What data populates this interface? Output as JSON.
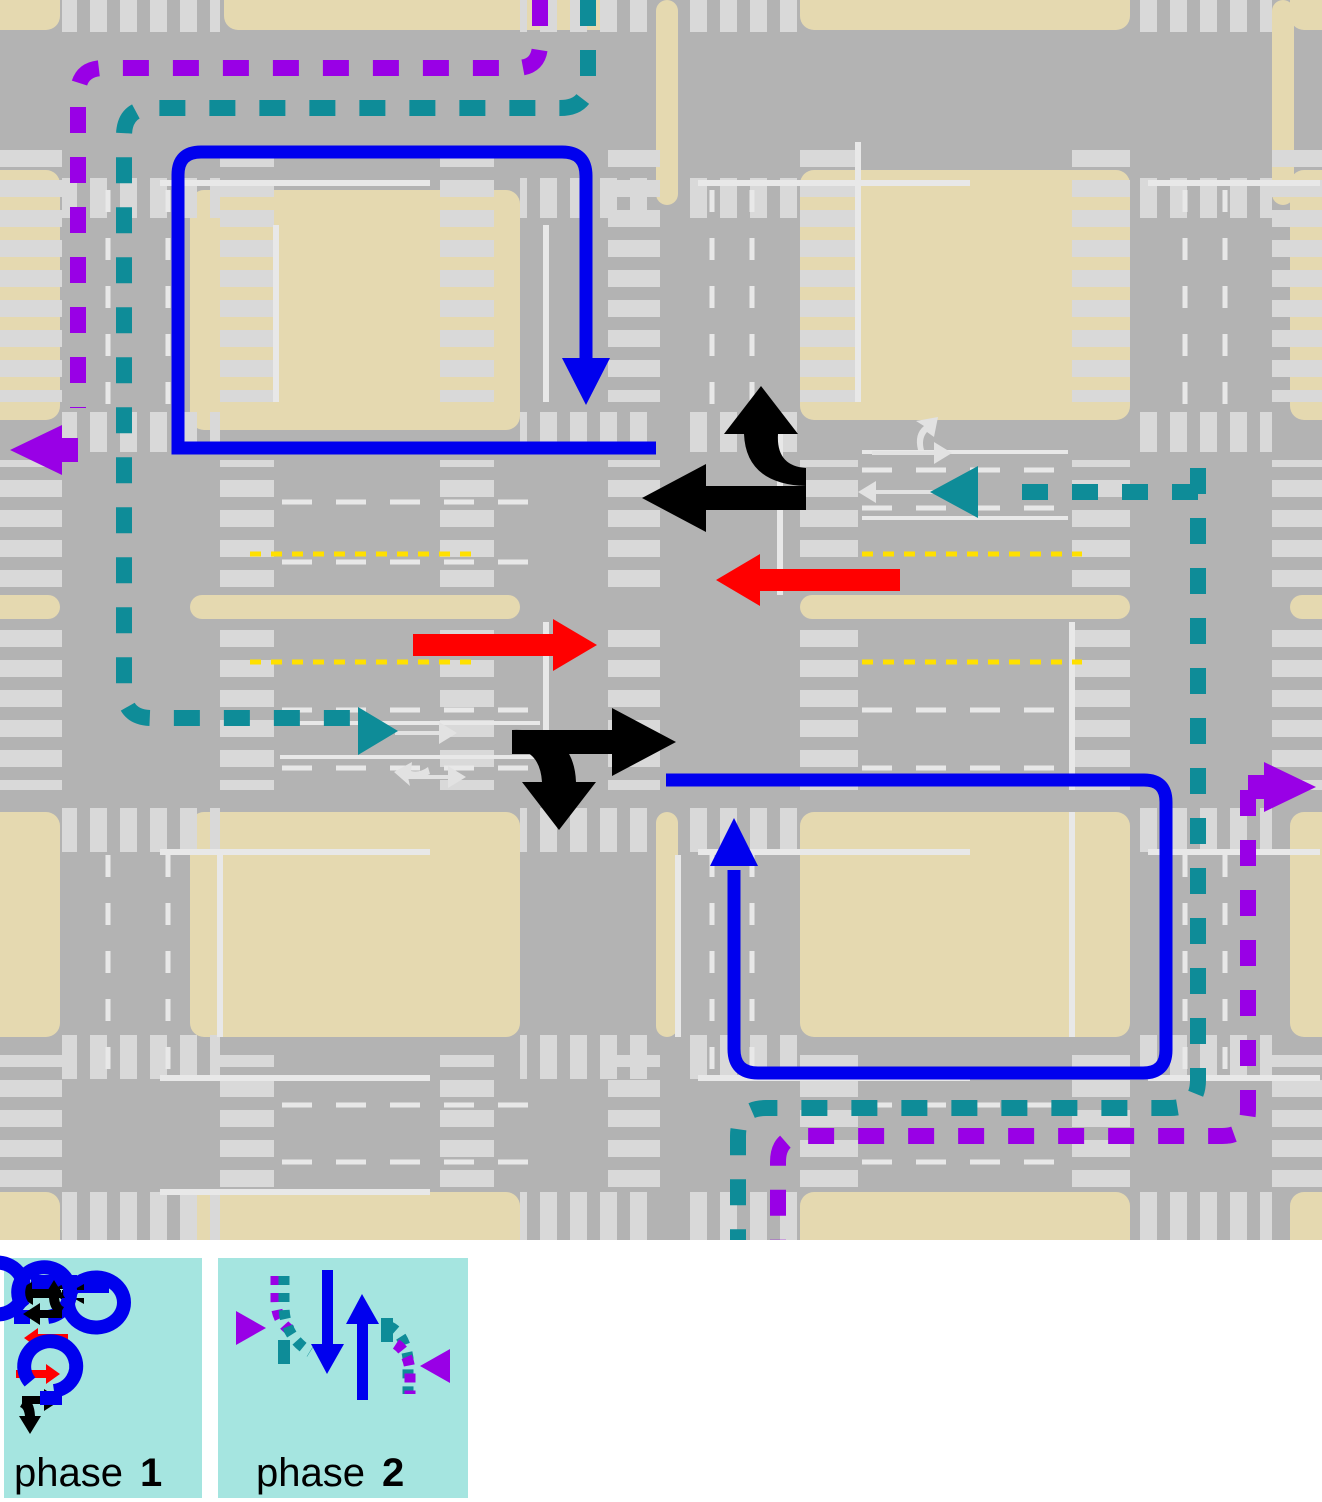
{
  "diagram": {
    "title": "Two-phase intersection signal movement diagram",
    "type": "traffic-network-map"
  },
  "colors": {
    "background_block": "#e5d9b0",
    "road": "#b3b3b3",
    "crosswalk": "#d9d9d9",
    "lane_marking": "#e8e8e8",
    "center_line_yellow": "#ffe000",
    "route_blue": "#0000ee",
    "route_red": "#ff0000",
    "route_black": "#000000",
    "route_teal": "#0e8c98",
    "route_purple": "#9900e6",
    "legend_panel": "#a5e5e0",
    "legend_text": "#000000",
    "page_background": "#ffffff"
  },
  "map": {
    "routes": [
      {
        "name": "blue-loop-upper-left",
        "color": "#0000ee",
        "style": "solid",
        "phase": 1,
        "movement": "u-turn-around-block",
        "arrow_direction": "down"
      },
      {
        "name": "blue-loop-lower-right",
        "color": "#0000ee",
        "style": "solid",
        "phase": 1,
        "movement": "u-turn-around-block",
        "arrow_direction": "up"
      },
      {
        "name": "red-arrow-westbound",
        "color": "#ff0000",
        "style": "solid",
        "phase": 1,
        "movement": "through-west"
      },
      {
        "name": "red-arrow-eastbound",
        "color": "#ff0000",
        "style": "solid",
        "phase": 1,
        "movement": "through-east"
      },
      {
        "name": "black-arrow-west-and-north",
        "color": "#000000",
        "style": "solid",
        "phase": 1,
        "movement": "through-west-plus-right-turn-north"
      },
      {
        "name": "black-arrow-east-and-south",
        "color": "#000000",
        "style": "solid",
        "phase": 1,
        "movement": "through-east-plus-right-turn-south"
      },
      {
        "name": "teal-dashed-route-upper",
        "color": "#0e8c98",
        "style": "dashed",
        "phase": 2,
        "movement": "left-turn-path"
      },
      {
        "name": "teal-dashed-route-lower",
        "color": "#0e8c98",
        "style": "dashed",
        "phase": 2,
        "movement": "left-turn-path"
      },
      {
        "name": "purple-dashed-route-upper",
        "color": "#9900e6",
        "style": "dashed",
        "phase": 2,
        "movement": "left-turn-path",
        "arrow_direction": "west"
      },
      {
        "name": "purple-dashed-route-lower",
        "color": "#9900e6",
        "style": "dashed",
        "phase": 2,
        "movement": "left-turn-path",
        "arrow_direction": "east"
      }
    ],
    "pavement_arrows": [
      {
        "name": "left-turn-and-through-marking-upper-right",
        "direction": "west"
      },
      {
        "name": "through-marking-upper-right",
        "direction": "west"
      },
      {
        "name": "through-marking-center-left",
        "direction": "east"
      },
      {
        "name": "right-turn-and-through-marking-center-left",
        "direction": "east"
      }
    ]
  },
  "legend": {
    "panels": [
      {
        "id": "phase-1",
        "label_prefix": "phase",
        "label_number": "1",
        "movements": [
          {
            "color": "#0000ee",
            "kind": "u-turn",
            "position": "top-left"
          },
          {
            "color": "#000000",
            "kind": "through-west-and-right-north",
            "position": "top-middle"
          },
          {
            "color": "#ff0000",
            "kind": "through-west",
            "position": "upper"
          },
          {
            "color": "#ff0000",
            "kind": "through-east",
            "position": "lower"
          },
          {
            "color": "#000000",
            "kind": "through-east-and-right-south",
            "position": "bottom-middle"
          },
          {
            "color": "#0000ee",
            "kind": "u-turn",
            "position": "bottom-right"
          }
        ]
      },
      {
        "id": "phase-2",
        "label_prefix": "phase",
        "label_number": "2",
        "movements": [
          {
            "color": "#9900e6",
            "kind": "left-turn-west",
            "style": "dashed"
          },
          {
            "color": "#0e8c98",
            "kind": "left-turn-curve",
            "style": "dashed"
          },
          {
            "color": "#0000ee",
            "kind": "through-south",
            "style": "solid"
          },
          {
            "color": "#0000ee",
            "kind": "through-north",
            "style": "solid"
          },
          {
            "color": "#0e8c98",
            "kind": "left-turn-curve",
            "style": "dashed"
          },
          {
            "color": "#9900e6",
            "kind": "left-turn-east",
            "style": "dashed"
          }
        ]
      }
    ]
  }
}
